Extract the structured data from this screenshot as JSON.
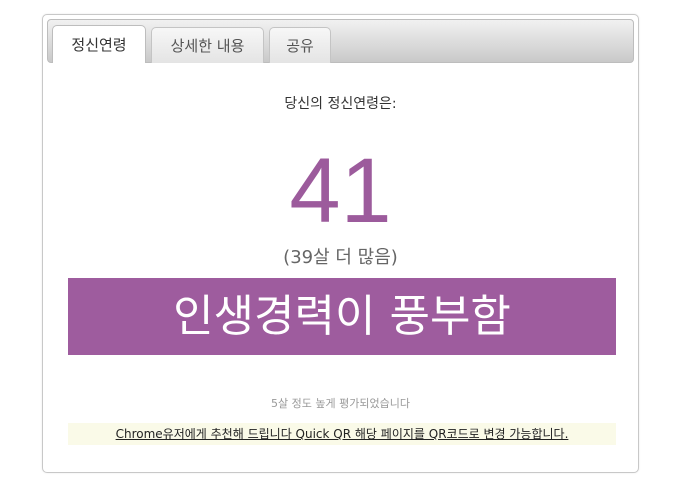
{
  "tabs": [
    {
      "label": "정신연령",
      "active": true
    },
    {
      "label": "상세한 내용",
      "active": false
    },
    {
      "label": "공유",
      "active": false
    }
  ],
  "result": {
    "subtitle": "당신의 정신연령은:",
    "age": "41",
    "difference": "(39살 더 많음)",
    "banner": "인생경력이 풍부함",
    "note": "5살 정도 높게 평가되었습니다"
  },
  "chrome_notice": {
    "link_text": "Chrome유저에게 추천해 드립니다 Quick QR 해당 페이지를 QR코드로 변경 가능합니다."
  },
  "colors": {
    "accent": "#9e5c9e",
    "age_text": "#9c5b9c"
  }
}
